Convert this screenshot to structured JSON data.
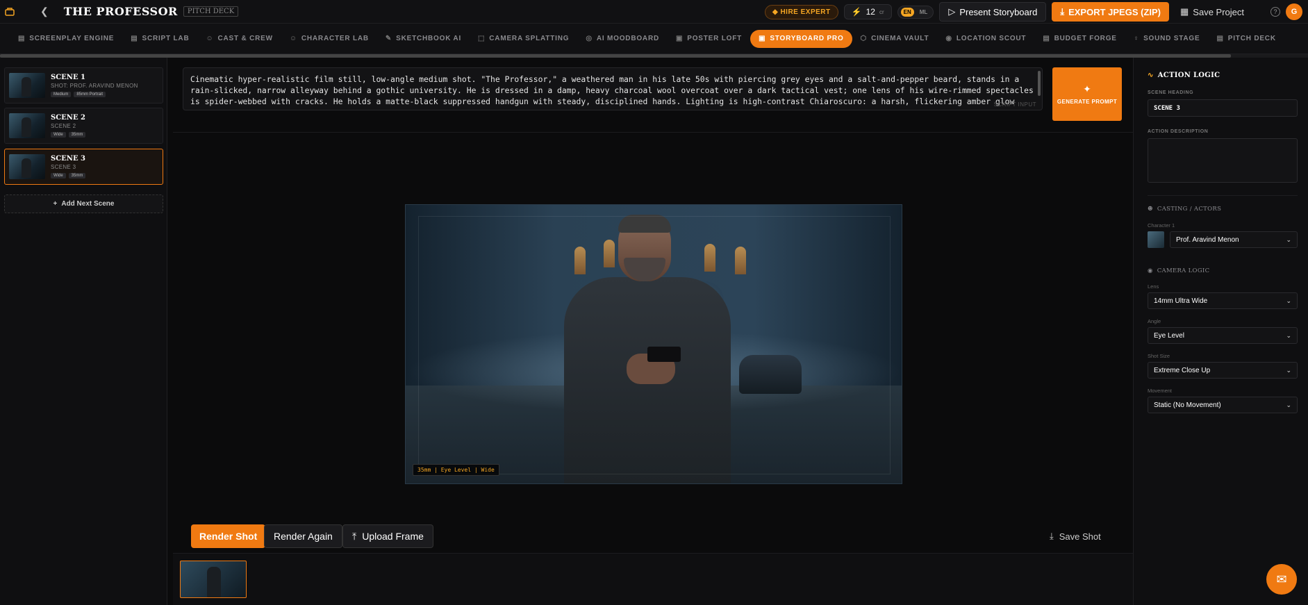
{
  "header": {
    "title": "THE PROFESSOR",
    "badge": "PITCH DECK",
    "hire_expert": "HIRE EXPERT",
    "credits": "12",
    "credits_unit": "cr",
    "lang_on": "EN",
    "lang_off": "ML",
    "present": "Present Storyboard",
    "export": "EXPORT JPEGS (ZIP)",
    "save_project": "Save Project",
    "avatar": "G"
  },
  "nav": [
    {
      "label": "SCREENPLAY ENGINE",
      "icon": "screenplay-icon"
    },
    {
      "label": "SCRIPT LAB",
      "icon": "script-icon"
    },
    {
      "label": "CAST & CREW",
      "icon": "users-icon"
    },
    {
      "label": "CHARACTER LAB",
      "icon": "character-icon"
    },
    {
      "label": "SKETCHBOOK AI",
      "icon": "pencil-icon"
    },
    {
      "label": "CAMERA SPLATTING",
      "icon": "camera-icon"
    },
    {
      "label": "AI MOODBOARD",
      "icon": "palette-icon"
    },
    {
      "label": "POSTER LOFT",
      "icon": "poster-icon"
    },
    {
      "label": "STORYBOARD PRO",
      "icon": "storyboard-icon",
      "active": true
    },
    {
      "label": "CINEMA VAULT",
      "icon": "vault-icon"
    },
    {
      "label": "LOCATION SCOUT",
      "icon": "location-icon"
    },
    {
      "label": "BUDGET FORGE",
      "icon": "budget-icon"
    },
    {
      "label": "SOUND STAGE",
      "icon": "mic-icon"
    },
    {
      "label": "PITCH DECK",
      "icon": "deck-icon"
    }
  ],
  "scenes": [
    {
      "title": "SCENE 1",
      "sub": "SHOT: PROF. ARAVIND MENON",
      "tags": [
        "Medium",
        "85mm Portrait"
      ]
    },
    {
      "title": "SCENE 2",
      "sub": "SCENE 2",
      "tags": [
        "Wide",
        "35mm"
      ]
    },
    {
      "title": "SCENE 3",
      "sub": "SCENE 3",
      "tags": [
        "Wide",
        "35mm"
      ],
      "selected": true
    }
  ],
  "add_scene": "Add Next Scene",
  "prompt": {
    "text": "Cinematic hyper-realistic film still, low-angle medium shot. \"The Professor,\" a weathered man in his late 50s with piercing grey eyes and a salt-and-pepper beard, stands in a rain-slicked, narrow alleyway behind a gothic university. He is dressed in a damp, heavy charcoal wool overcoat over a dark tactical vest; one lens of his wire-rimmed spectacles is spider-webbed with cracks. He holds a matte-black suppressed handgun with steady, disciplined hands. Lighting is high-contrast Chiaroscuro: a harsh, flickering amber glow from an overhead sodium lamp clashes with cool, deep blue moonlight. Atmospheric volumetric fog swirls around his legs. Textures are ultra-detailed: individual beads of rain on the wool",
    "hint": "SCRIPT INPUT"
  },
  "generate_prompt": "GENERATE PROMPT",
  "viewer_tag": "35mm | Eye Level | Wide",
  "actions": {
    "render_shot": "Render Shot",
    "render_again": "Render Again",
    "upload_frame": "Upload Frame",
    "save_shot": "Save Shot"
  },
  "panel": {
    "title": "ACTION LOGIC",
    "scene_heading_label": "SCENE HEADING",
    "scene_heading_value": "SCENE 3",
    "action_description_label": "ACTION DESCRIPTION",
    "action_description_value": "",
    "casting_title": "CASTING / ACTORS",
    "character_label": "Character 1",
    "character_value": "Prof. Aravind Menon",
    "camera_title": "CAMERA LOGIC",
    "lens_label": "Lens",
    "lens_value": "14mm Ultra Wide",
    "angle_label": "Angle",
    "angle_value": "Eye Level",
    "shot_size_label": "Shot Size",
    "shot_size_value": "Extreme Close Up",
    "movement_label": "Movement",
    "movement_value": "Static (No Movement)"
  },
  "colors": {
    "accent": "#f07a12",
    "accent_text": "#f5a623",
    "background": "#0b0b0c",
    "panel": "#0f0f11"
  }
}
